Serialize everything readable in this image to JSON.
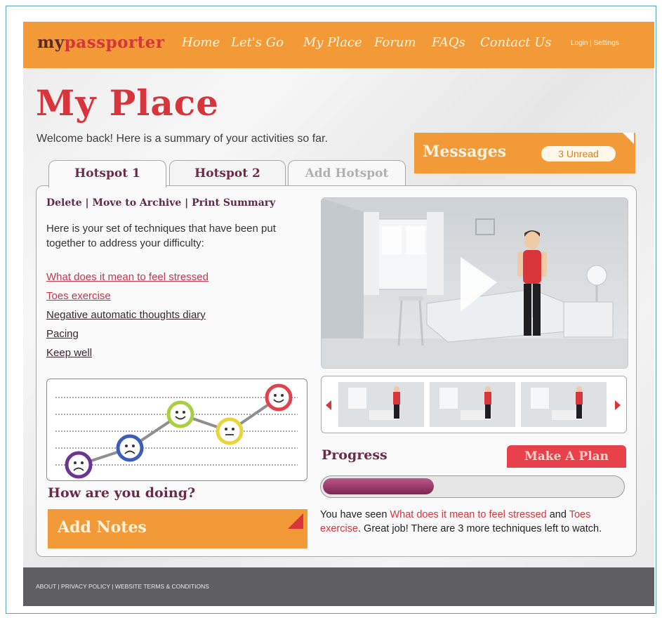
{
  "header": {
    "logo_part1": "my",
    "logo_part2": "passporter",
    "nav": [
      "Home",
      "Let's Go",
      "My Place",
      "Forum",
      "FAQs",
      "Contact Us"
    ],
    "login": "Login | Settings"
  },
  "page": {
    "title": "My Place",
    "welcome": "Welcome back! Here is a summary of your activities so far."
  },
  "messages": {
    "label": "Messages",
    "badge": "3 Unread"
  },
  "tabs": [
    "Hotspot 1",
    "Hotspot 2",
    "Add Hotspot"
  ],
  "actions": {
    "delete": "Delete",
    "archive": "Move to Archive",
    "print": "Print Summary",
    "separator": " | "
  },
  "intro": "Here is your set of techniques that have been put together to address your difficulty:",
  "techniques": [
    {
      "label": "What does it mean to feel stressed",
      "seen": true
    },
    {
      "label": "Toes exercise",
      "seen": true
    },
    {
      "label": "Negative automatic thoughts diary",
      "seen": false
    },
    {
      "label": "Pacing",
      "seen": false
    },
    {
      "label": "Keep well",
      "seen": false
    }
  ],
  "mood": {
    "heading": "How are you doing?",
    "levels": [
      1,
      2,
      4,
      3,
      5
    ],
    "colors": [
      "#6b3591",
      "#3c5db8",
      "#a9cf3f",
      "#e9d43a",
      "#e2404a"
    ]
  },
  "add_notes": "Add Notes",
  "progress": {
    "label": "Progress",
    "make_plan": "Make A Plan",
    "fraction": 0.37,
    "summary_pre": "You have seen ",
    "item1": "What does it mean to feel stressed",
    "mid": " and ",
    "item2": "Toes exercise",
    "summary_post": ". Great job! There are 3 more techniques left to watch."
  },
  "footer": {
    "links": "ABOUT | PRIVACY POLICY | WEBSITE TERMS & CONDITIONS"
  },
  "colors": {
    "orange": "#f39a38",
    "red": "#d8343b",
    "plum": "#6d2a47",
    "footer": "#5f5f63"
  }
}
